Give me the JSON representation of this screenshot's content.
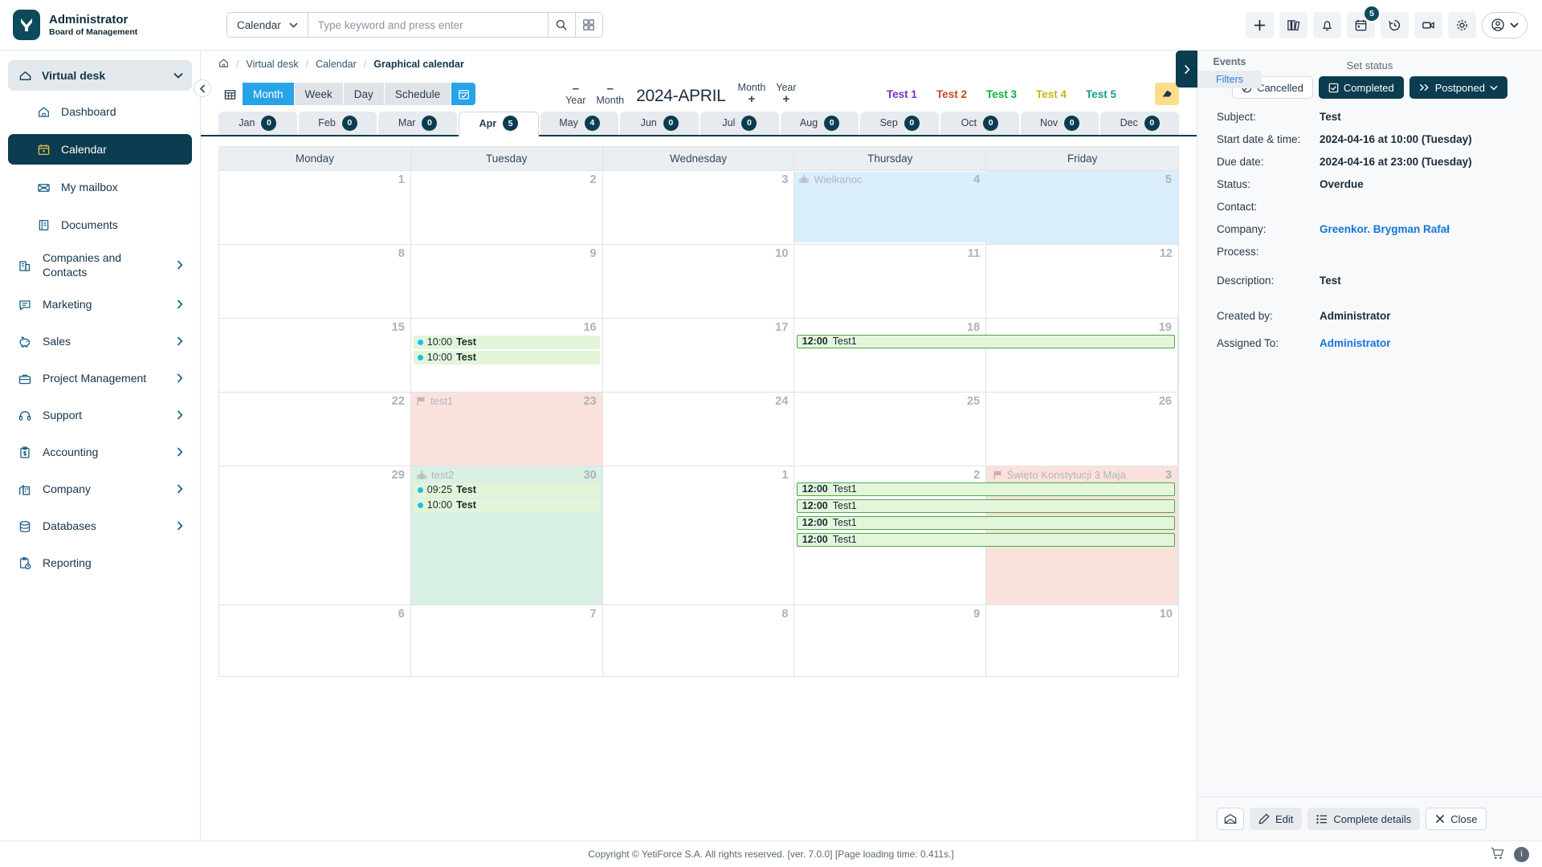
{
  "topbar": {
    "brand_name": "Administrator",
    "brand_sub": "Board of Management",
    "search_module": "Calendar",
    "search_placeholder": "Type keyword and press enter",
    "notification_badge": "5"
  },
  "sidebar": {
    "group": {
      "label": "Virtual desk"
    },
    "sub_items": [
      {
        "label": "Dashboard",
        "icon": "home-icon"
      },
      {
        "label": "Calendar",
        "icon": "calendar-icon"
      },
      {
        "label": "My mailbox",
        "icon": "mail-icon"
      },
      {
        "label": "Documents",
        "icon": "documents-icon"
      }
    ],
    "main_items": [
      {
        "label": "Companies and Contacts",
        "icon": "building-icon"
      },
      {
        "label": "Marketing",
        "icon": "chat-icon"
      },
      {
        "label": "Sales",
        "icon": "piggy-bank-icon"
      },
      {
        "label": "Project Management",
        "icon": "briefcase-icon"
      },
      {
        "label": "Support",
        "icon": "headset-icon"
      },
      {
        "label": "Accounting",
        "icon": "invoice-icon"
      },
      {
        "label": "Company",
        "icon": "company-icon"
      },
      {
        "label": "Databases",
        "icon": "database-icon"
      },
      {
        "label": "Reporting",
        "icon": "report-icon"
      }
    ]
  },
  "breadcrumb": {
    "items": [
      "Virtual desk",
      "Calendar"
    ],
    "current": "Graphical calendar"
  },
  "toolbar": {
    "views": [
      "Month",
      "Week",
      "Day",
      "Schedule"
    ],
    "active_view": "Month",
    "nav": [
      {
        "sym": "–",
        "label": "Year"
      },
      {
        "sym": "–",
        "label": "Month"
      }
    ],
    "nav_right": [
      {
        "label": "Month",
        "sym": "+"
      },
      {
        "label": "Year",
        "sym": "+"
      }
    ],
    "period": "2024-APRIL",
    "tests": [
      {
        "label": "Test 1",
        "color": "#7b2fbe"
      },
      {
        "label": "Test 2",
        "color": "#c7491b"
      },
      {
        "label": "Test 3",
        "color": "#0fae3e"
      },
      {
        "label": "Test 4",
        "color": "#c5b70f"
      },
      {
        "label": "Test 5",
        "color": "#12a08a"
      }
    ]
  },
  "month_tabs": [
    {
      "label": "Jan",
      "count": "0",
      "active": false
    },
    {
      "label": "Feb",
      "count": "0",
      "active": false
    },
    {
      "label": "Mar",
      "count": "0",
      "active": false
    },
    {
      "label": "Apr",
      "count": "5",
      "active": true
    },
    {
      "label": "May",
      "count": "4",
      "active": false
    },
    {
      "label": "Jun",
      "count": "0",
      "active": false
    },
    {
      "label": "Jul",
      "count": "0",
      "active": false
    },
    {
      "label": "Aug",
      "count": "0",
      "active": false
    },
    {
      "label": "Sep",
      "count": "0",
      "active": false
    },
    {
      "label": "Oct",
      "count": "0",
      "active": false
    },
    {
      "label": "Nov",
      "count": "0",
      "active": false
    },
    {
      "label": "Dec",
      "count": "0",
      "active": false
    }
  ],
  "calendar": {
    "weekdays": [
      "Monday",
      "Tuesday",
      "Wednesday",
      "Thursday",
      "Friday"
    ],
    "weeks": [
      {
        "days": [
          {
            "num": "1",
            "bg": ""
          },
          {
            "num": "2",
            "bg": ""
          },
          {
            "num": "3",
            "bg": ""
          },
          {
            "num": "4",
            "bg": ""
          },
          {
            "num": "5",
            "bg": "blue"
          }
        ],
        "allday": {
          "label": "Wielkanoc",
          "icon": "church-icon",
          "start": 3,
          "span": 2
        },
        "day4_tint": "blue"
      },
      {
        "days": [
          {
            "num": "8",
            "bg": ""
          },
          {
            "num": "9",
            "bg": ""
          },
          {
            "num": "10",
            "bg": ""
          },
          {
            "num": "11",
            "bg": ""
          },
          {
            "num": "12",
            "bg": ""
          }
        ]
      },
      {
        "days": [
          {
            "num": "15",
            "bg": ""
          },
          {
            "num": "16",
            "bg": ""
          },
          {
            "num": "17",
            "bg": ""
          },
          {
            "num": "18",
            "bg": ""
          },
          {
            "num": "19",
            "bg": ""
          }
        ],
        "events_tue": [
          {
            "time": "10:00",
            "subject": "Test"
          },
          {
            "time": "10:00",
            "subject": "Test"
          }
        ],
        "span_event": {
          "time": "12:00",
          "subject": "Test1",
          "start": 3,
          "span": 2
        }
      },
      {
        "days": [
          {
            "num": "22",
            "bg": ""
          },
          {
            "num": "23",
            "bg": "pink"
          },
          {
            "num": "24",
            "bg": ""
          },
          {
            "num": "25",
            "bg": ""
          },
          {
            "num": "26",
            "bg": ""
          }
        ],
        "allday": {
          "label": "test1",
          "icon": "flag-icon",
          "start": 1,
          "span": 1
        }
      },
      {
        "days": [
          {
            "num": "29",
            "bg": ""
          },
          {
            "num": "30",
            "bg": "green"
          },
          {
            "num": "1",
            "bg": ""
          },
          {
            "num": "2",
            "bg": ""
          },
          {
            "num": "3",
            "bg": "pink"
          }
        ],
        "allday": {
          "label": "test2",
          "icon": "church-icon",
          "start": 1,
          "span": 1
        },
        "allday2": {
          "label": "Święto Konstytucji 3 Maja",
          "icon": "flag-icon",
          "start": 4,
          "span": 1
        },
        "events_tue": [
          {
            "time": "09:25",
            "subject": "Test"
          },
          {
            "time": "10:00",
            "subject": "Test"
          }
        ],
        "span_events": [
          {
            "time": "12:00",
            "subject": "Test1"
          },
          {
            "time": "12:00",
            "subject": "Test1"
          },
          {
            "time": "12:00",
            "subject": "Test1"
          },
          {
            "time": "12:00",
            "subject": "Test1"
          }
        ]
      },
      {
        "days": [
          {
            "num": "6",
            "bg": ""
          },
          {
            "num": "7",
            "bg": ""
          },
          {
            "num": "8",
            "bg": ""
          },
          {
            "num": "9",
            "bg": ""
          },
          {
            "num": "10",
            "bg": ""
          }
        ]
      }
    ]
  },
  "panel": {
    "tab_events": "Events",
    "tab_filters": "Filters",
    "set_status_label": "Set status",
    "status_buttons": [
      {
        "label": "Cancelled",
        "icon": "ban-icon",
        "active": false
      },
      {
        "label": "Completed",
        "icon": "check-square-icon",
        "active": true
      },
      {
        "label": "Postponed",
        "icon": "forward-icon",
        "active": true,
        "caret": true
      }
    ],
    "fields": [
      {
        "label": "Subject:",
        "value": "Test",
        "link": false
      },
      {
        "label": "Start date & time:",
        "value": "2024-04-16 at 10:00 (Tuesday)",
        "link": false
      },
      {
        "label": "Due date:",
        "value": "2024-04-16 at 23:00 (Tuesday)",
        "link": false
      },
      {
        "label": "Status:",
        "value": "Overdue",
        "link": false
      },
      {
        "label": "Contact:",
        "value": "",
        "link": false
      },
      {
        "label": "Company:",
        "value": "Greenkor. Brygman Rafał",
        "link": true
      },
      {
        "label": "Process:",
        "value": "",
        "link": false
      },
      {
        "label": "Description:",
        "value": "Test",
        "link": false
      },
      {
        "label": "Created by:",
        "value": "Administrator",
        "link": false
      },
      {
        "label": "Assigned To:",
        "value": "Administrator",
        "link": true
      }
    ],
    "footer_buttons": [
      {
        "label": "",
        "icon": "mail-open-icon"
      },
      {
        "label": "Edit",
        "icon": "pencil-icon"
      },
      {
        "label": "Complete details",
        "icon": "list-icon"
      },
      {
        "label": "Close",
        "icon": "close-icon"
      }
    ]
  },
  "footer": {
    "text": "Copyright © YetiForce S.A. All rights reserved. [ver. 7.0.0] [Page loading time: 0.411s.]",
    "info_badge": "i"
  }
}
